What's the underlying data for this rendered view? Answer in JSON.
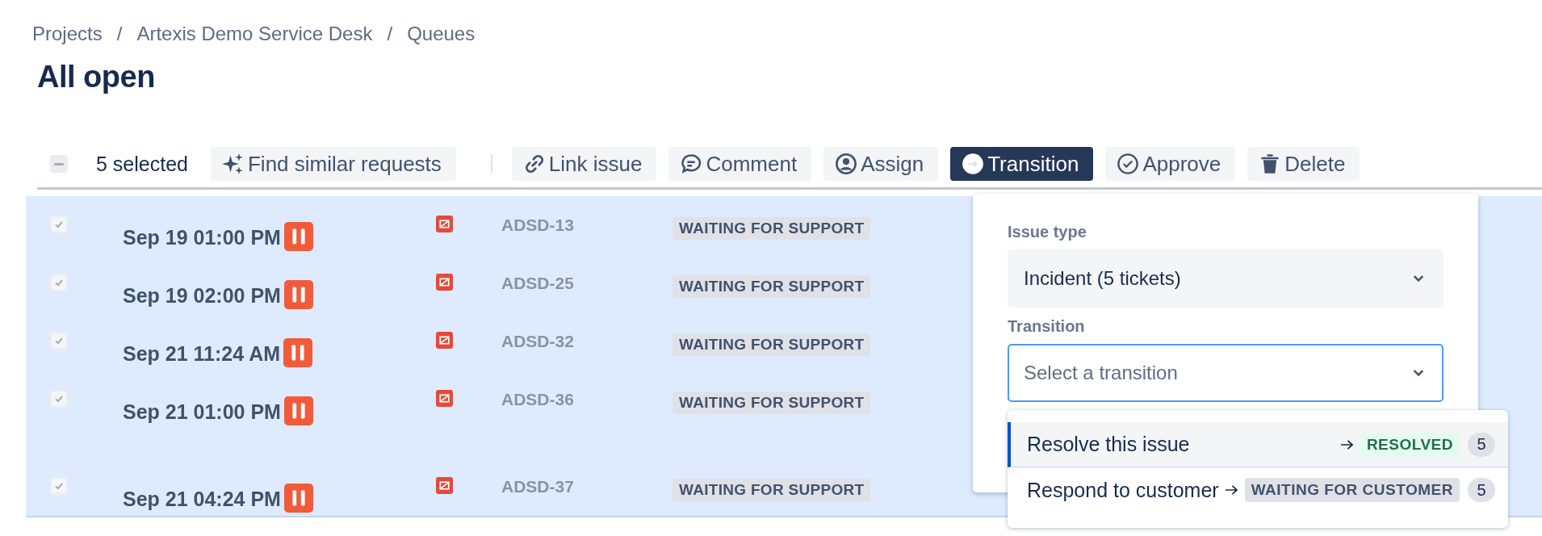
{
  "breadcrumbs": [
    "Projects",
    "Artexis Demo Service Desk",
    "Queues"
  ],
  "breadcrumb_separator": "/",
  "title": "All open",
  "toolbar": {
    "select_all_indeterminate": true,
    "selected_count": "5 selected",
    "actions": [
      {
        "label": "Find similar requests",
        "selected": false
      },
      {
        "label": "Link issue",
        "selected": false
      },
      {
        "label": "Comment",
        "selected": false
      },
      {
        "label": "Assign",
        "selected": false
      },
      {
        "label": "Transition",
        "selected": true
      },
      {
        "label": "Approve",
        "selected": false
      },
      {
        "label": "Delete",
        "selected": false
      }
    ]
  },
  "rows": [
    {
      "checked": true,
      "selected": true,
      "date": "Sep 19 01:00 PM",
      "key": "ADSD-13",
      "status": "WAITING FOR SUPPORT"
    },
    {
      "checked": true,
      "selected": true,
      "date": "Sep 19 02:00 PM",
      "key": "ADSD-25",
      "status": "WAITING FOR SUPPORT"
    },
    {
      "checked": true,
      "selected": true,
      "date": "Sep 21 11:24 AM",
      "key": "ADSD-32",
      "status": "WAITING FOR SUPPORT"
    },
    {
      "checked": true,
      "selected": true,
      "date": "Sep 21 01:00 PM",
      "key": "ADSD-36",
      "status": "WAITING FOR SUPPORT"
    },
    {
      "checked": true,
      "selected": true,
      "date": "Sep 21 04:24 PM",
      "key": "ADSD-37",
      "status": "WAITING FOR SUPPORT"
    }
  ],
  "popup": {
    "issue_type_label": "Issue type",
    "issue_type_value": "Incident (5 tickets)",
    "transition_label": "Transition",
    "transition_placeholder": "Select a transition",
    "transition_focused": true,
    "options": [
      {
        "label": "Resolve this issue",
        "target": "RESOLVED",
        "kind": "success",
        "count": "5",
        "selected": true
      },
      {
        "label": "Respond to customer",
        "target": "WAITING FOR CUSTOMER",
        "kind": "default",
        "count": "5",
        "selected": false
      }
    ]
  }
}
